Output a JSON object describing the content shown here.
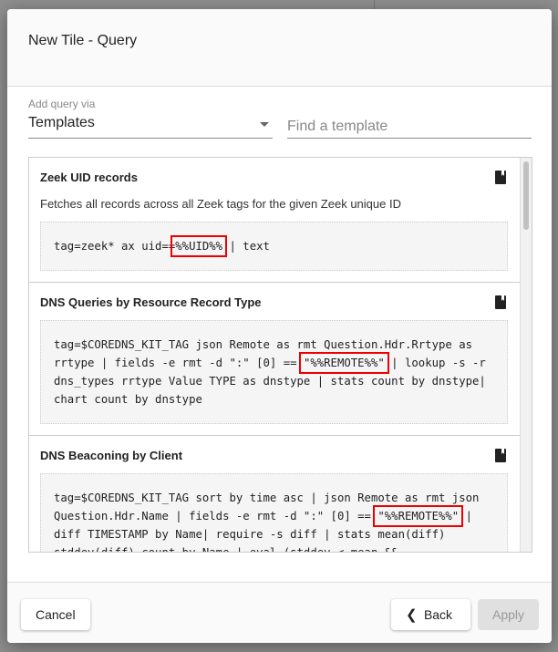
{
  "dialog": {
    "title": "New Tile - Query"
  },
  "add_via": {
    "label": "Add query via",
    "value": "Templates"
  },
  "search": {
    "placeholder": "Find a template"
  },
  "templates": [
    {
      "title": "Zeek UID records",
      "description": "Fetches all records across all Zeek tags for the given Zeek unique ID",
      "code_pre": "tag=zeek* ax uid==",
      "code_hl": "%%UID%%",
      "code_post": " | text"
    },
    {
      "title": "DNS Queries by Resource Record Type",
      "code_pre": "tag=$COREDNS_KIT_TAG json Remote as rmt Question.Hdr.Rrtype as rrtype | fields -e rmt -d \":\" [0] == ",
      "code_hl": "\"%%REMOTE%%\"",
      "code_post": " | lookup -s -r dns_types rrtype Value TYPE as dnstype | stats count by dnstype| chart count by dnstype"
    },
    {
      "title": "DNS Beaconing by Client",
      "code_pre": "tag=$COREDNS_KIT_TAG sort by time asc | json Remote as rmt json Question.Hdr.Name | fields -e rmt -d \":\" [0] == ",
      "code_hl": "\"%%REMOTE%%\"",
      "code_post": " | diff TIMESTAMP by Name| require -s diff | stats mean(diff) stddev(diff) count by Name | eval (stddev < mean &&"
    }
  ],
  "footer": {
    "cancel": "Cancel",
    "back": "Back",
    "apply": "Apply"
  }
}
